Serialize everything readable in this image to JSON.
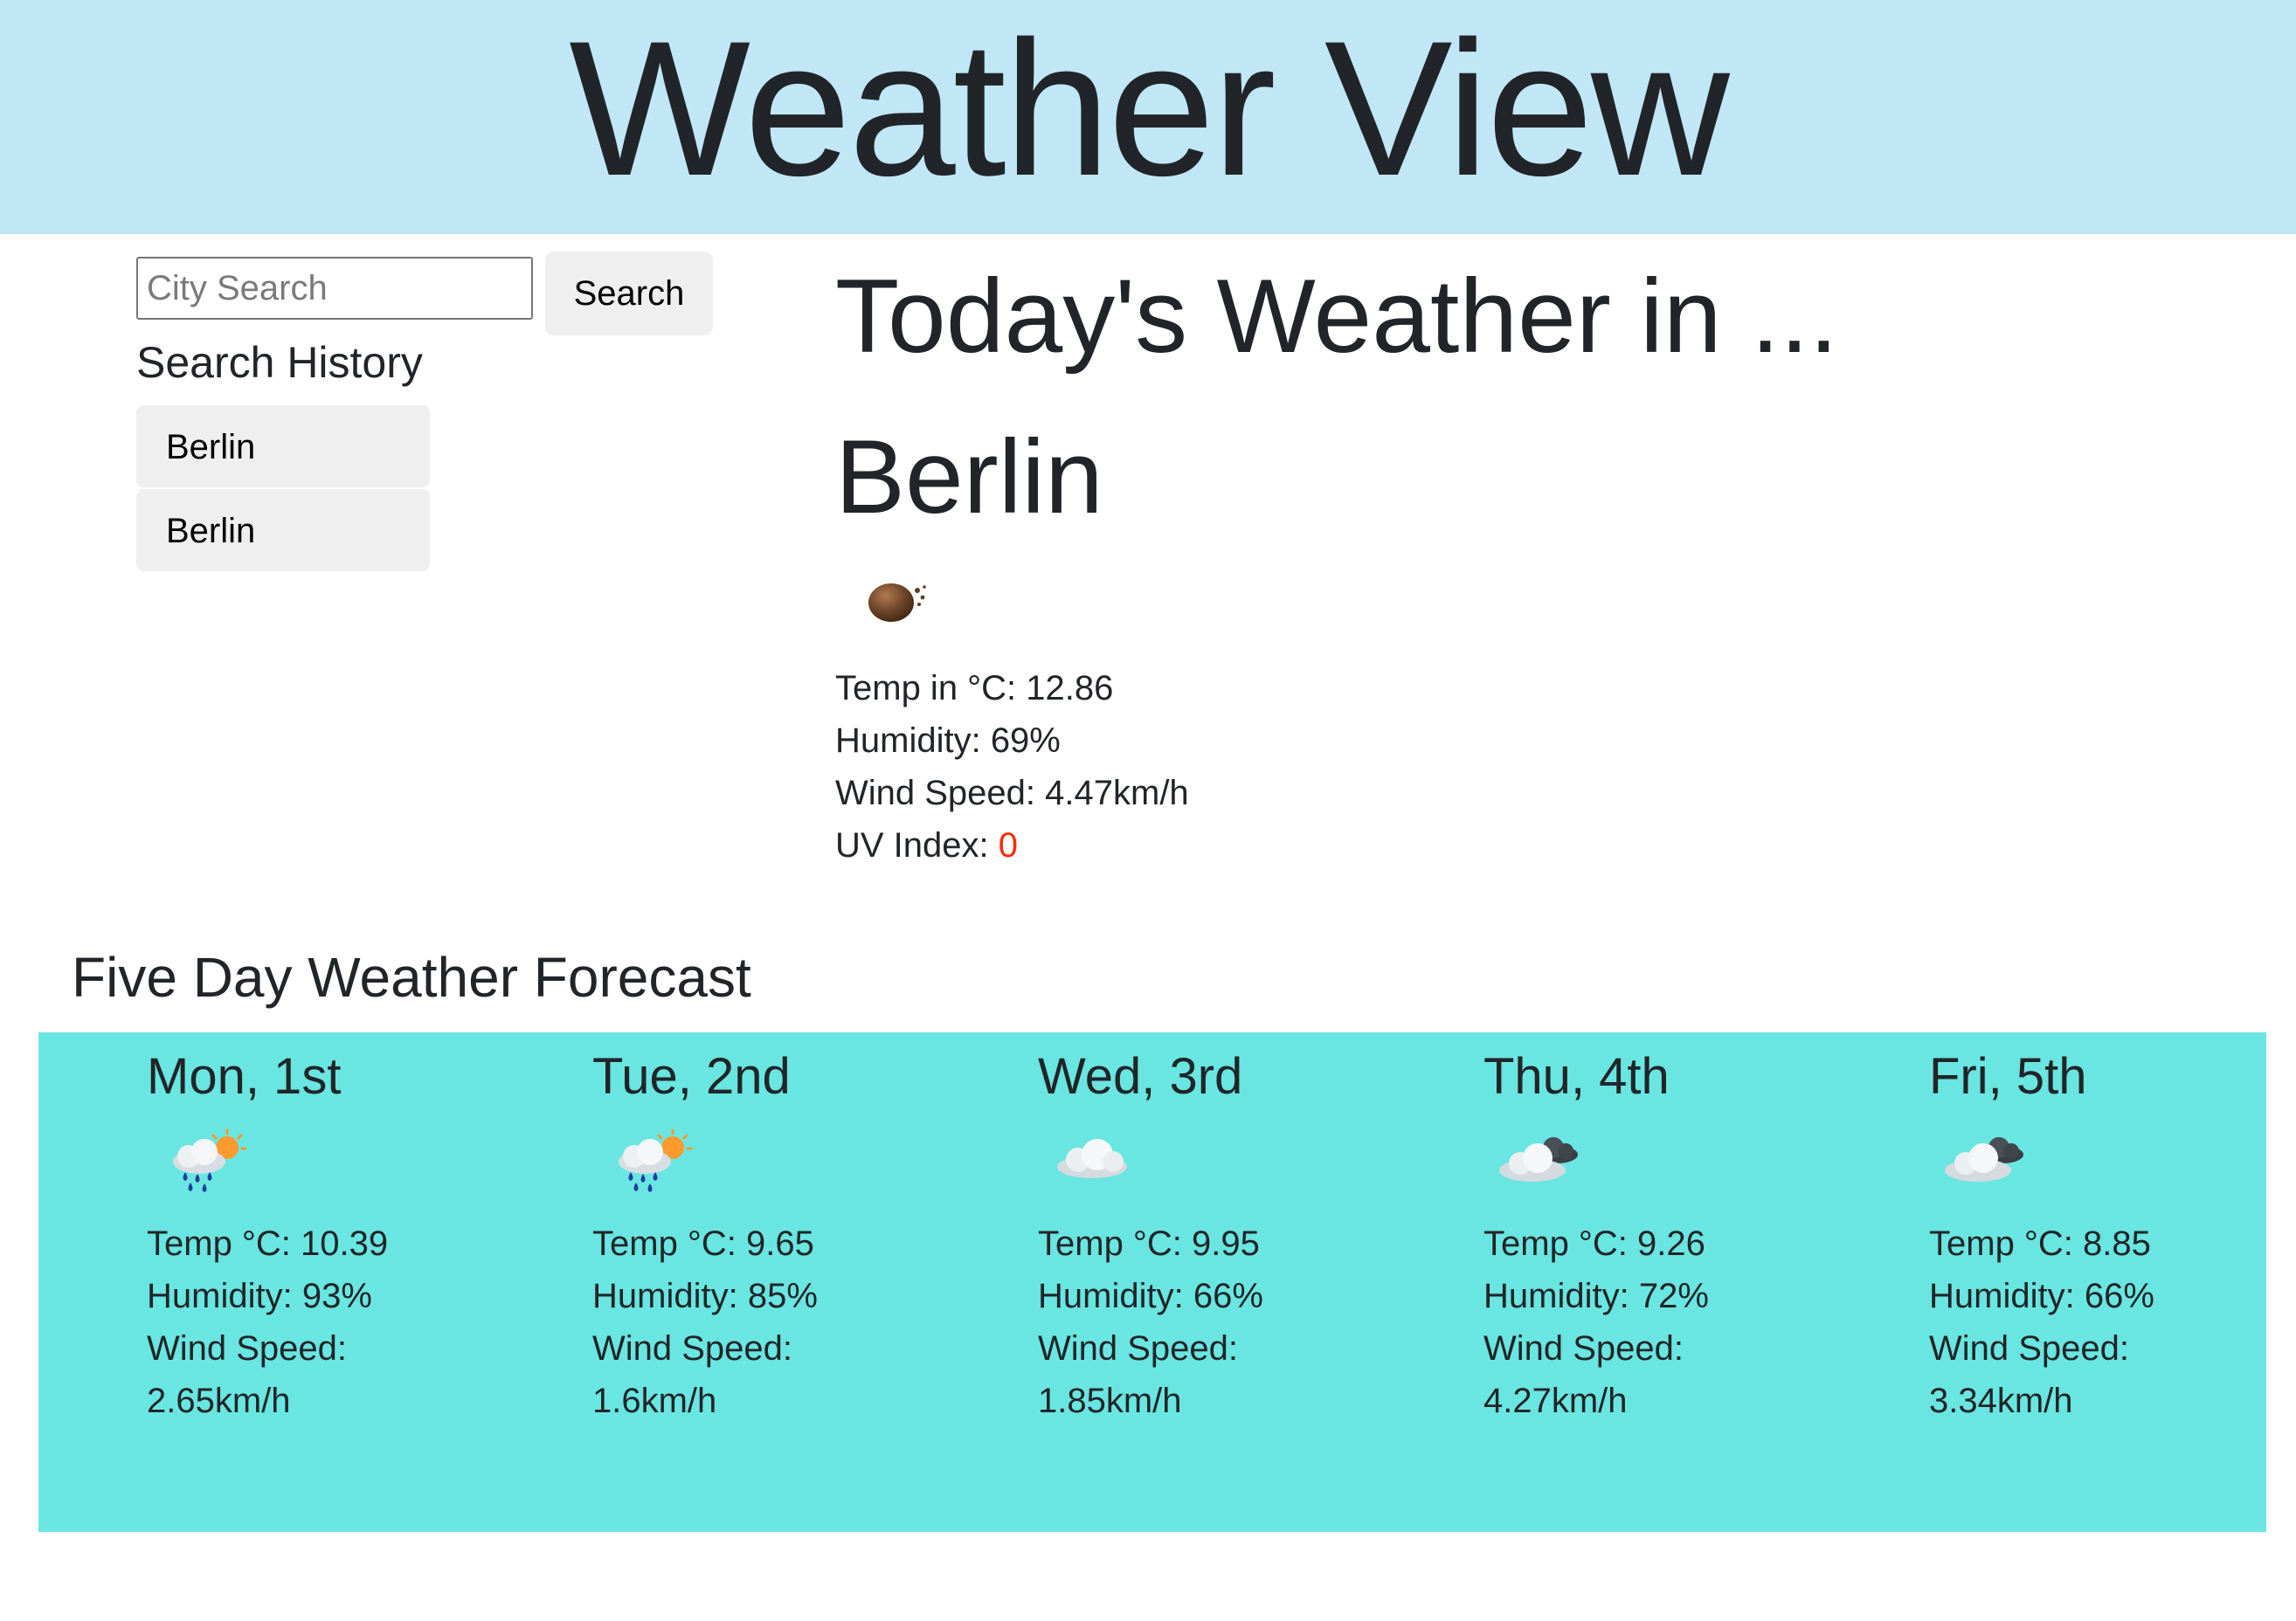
{
  "header": {
    "title": "Weather View"
  },
  "search": {
    "placeholder": "City Search",
    "value": "",
    "button_label": "Search"
  },
  "history": {
    "title": "Search History",
    "items": [
      {
        "label": "Berlin"
      },
      {
        "label": "Berlin"
      }
    ]
  },
  "current": {
    "heading": "Today's Weather in ...",
    "city": "Berlin",
    "icon": "mist-icon",
    "temp_label": "Temp in °C: ",
    "temp_value": "12.86",
    "humidity_label": "Humidity: ",
    "humidity_value": "69%",
    "wind_label": "Wind Speed: ",
    "wind_value": "4.47km/h",
    "uv_label": "UV Index: ",
    "uv_value": "0",
    "uv_color": "#ff2a00"
  },
  "forecast": {
    "title": "Five Day Weather Forecast",
    "band_color": "#69e6e1",
    "days": [
      {
        "date": "Mon, 1st",
        "icon": "rain-sun-icon",
        "temp_label": "Temp °C:",
        "temp": "10.39",
        "humidity_label": "Humidity:",
        "humidity": "93%",
        "wind_label": "Wind Speed:",
        "wind": "2.65km/h"
      },
      {
        "date": "Tue, 2nd",
        "icon": "rain-sun-icon",
        "temp_label": "Temp °C:",
        "temp": "9.65",
        "humidity_label": "Humidity:",
        "humidity": "85%",
        "wind_label": "Wind Speed:",
        "wind": "1.6km/h"
      },
      {
        "date": "Wed, 3rd",
        "icon": "cloud-icon",
        "temp_label": "Temp °C:",
        "temp": "9.95",
        "humidity_label": "Humidity:",
        "humidity": "66%",
        "wind_label": "Wind Speed:",
        "wind": "1.85km/h"
      },
      {
        "date": "Thu, 4th",
        "icon": "broken-clouds-icon",
        "temp_label": "Temp °C:",
        "temp": "9.26",
        "humidity_label": "Humidity:",
        "humidity": "72%",
        "wind_label": "Wind Speed:",
        "wind": "4.27km/h"
      },
      {
        "date": "Fri, 5th",
        "icon": "broken-clouds-icon",
        "temp_label": "Temp °C:",
        "temp": "8.85",
        "humidity_label": "Humidity:",
        "humidity": "66%",
        "wind_label": "Wind Speed:",
        "wind": "3.34km/h"
      }
    ]
  }
}
